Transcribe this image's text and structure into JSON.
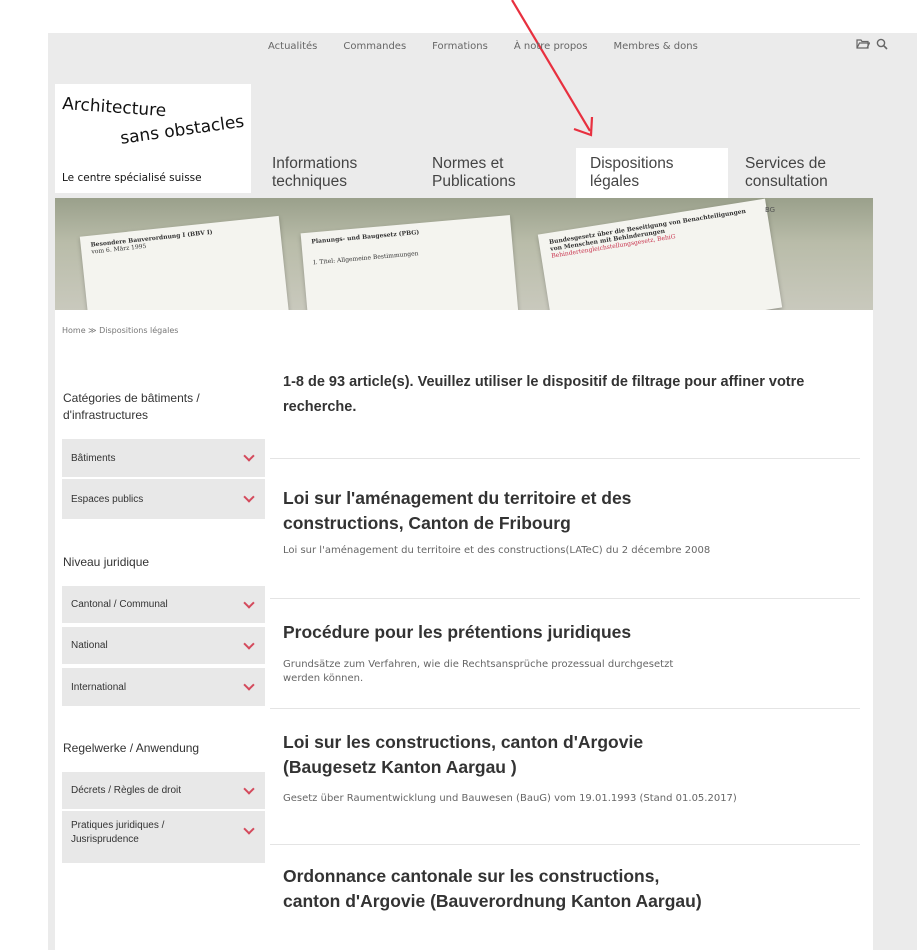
{
  "topnav": [
    "Actualités",
    "Commandes",
    "Formations",
    "À notre propos",
    "Membres & dons"
  ],
  "logo": {
    "line1": "Architecture",
    "line2": "sans obstacles",
    "tagline": "Le centre spécialisé suisse"
  },
  "mainnav": [
    {
      "label": "Informations techniques"
    },
    {
      "label": "Normes et Publications"
    },
    {
      "label": "Dispositions légales"
    },
    {
      "label": "Services de consultation"
    }
  ],
  "annotation": {
    "arrow_color": "#e8303f"
  },
  "hero": {
    "papers": [
      {
        "title": "Besondere Bauverordnung I (BBV I)",
        "sub": "vom 6. März 1995"
      },
      {
        "title": "Planungs- und Baugesetz (PBG)",
        "sub": "I. Titel: Allgemeine Bestimmungen"
      },
      {
        "title": "Bundesgesetz über die Beseitigung von Benachteiligungen von Menschen mit Behinderungen",
        "red": "Behindertengleichstellungsgesetz, BehiG"
      }
    ],
    "tag": "BG"
  },
  "breadcrumb": "Home ≫ Dispositions légales",
  "sidebar": {
    "groups": [
      {
        "heading": "Catégories de bâtiments / d'infrastructures",
        "items": [
          "Bâtiments",
          "Espaces publics"
        ]
      },
      {
        "heading": "Niveau juridique",
        "items": [
          "Cantonal / Communal",
          "National",
          "International"
        ]
      },
      {
        "heading": "Regelwerke / Anwendung",
        "items": [
          "Décrets / Règles de droit",
          "Pratiques juridiques / Jusrisprudence"
        ]
      }
    ]
  },
  "results": {
    "summary": "1-8 de 93 article(s). Veuillez utiliser le dispositif de filtrage pour affiner votre recherche."
  },
  "articles": [
    {
      "title": "Loi sur l'aménagement du territoire et des constructions, Canton de Fribourg",
      "desc": "Loi sur l'aménagement du territoire et des constructions(LATeC) du 2 décembre 2008"
    },
    {
      "title": "Procédure pour les prétentions juridiques",
      "desc": "Grundsätze zum Verfahren, wie die Rechtsansprüche prozessual durchgesetzt werden können."
    },
    {
      "title": "Loi sur les constructions, canton d'Argovie (Baugesetz Kanton Aargau )",
      "desc": "Gesetz über Raumentwicklung und Bauwesen (BauG) vom 19.01.1993 (Stand 01.05.2017)"
    },
    {
      "title": "Ordonnance cantonale sur les constructions, canton d'Argovie (Bauverordnung Kanton Aargau)",
      "desc": ""
    }
  ]
}
